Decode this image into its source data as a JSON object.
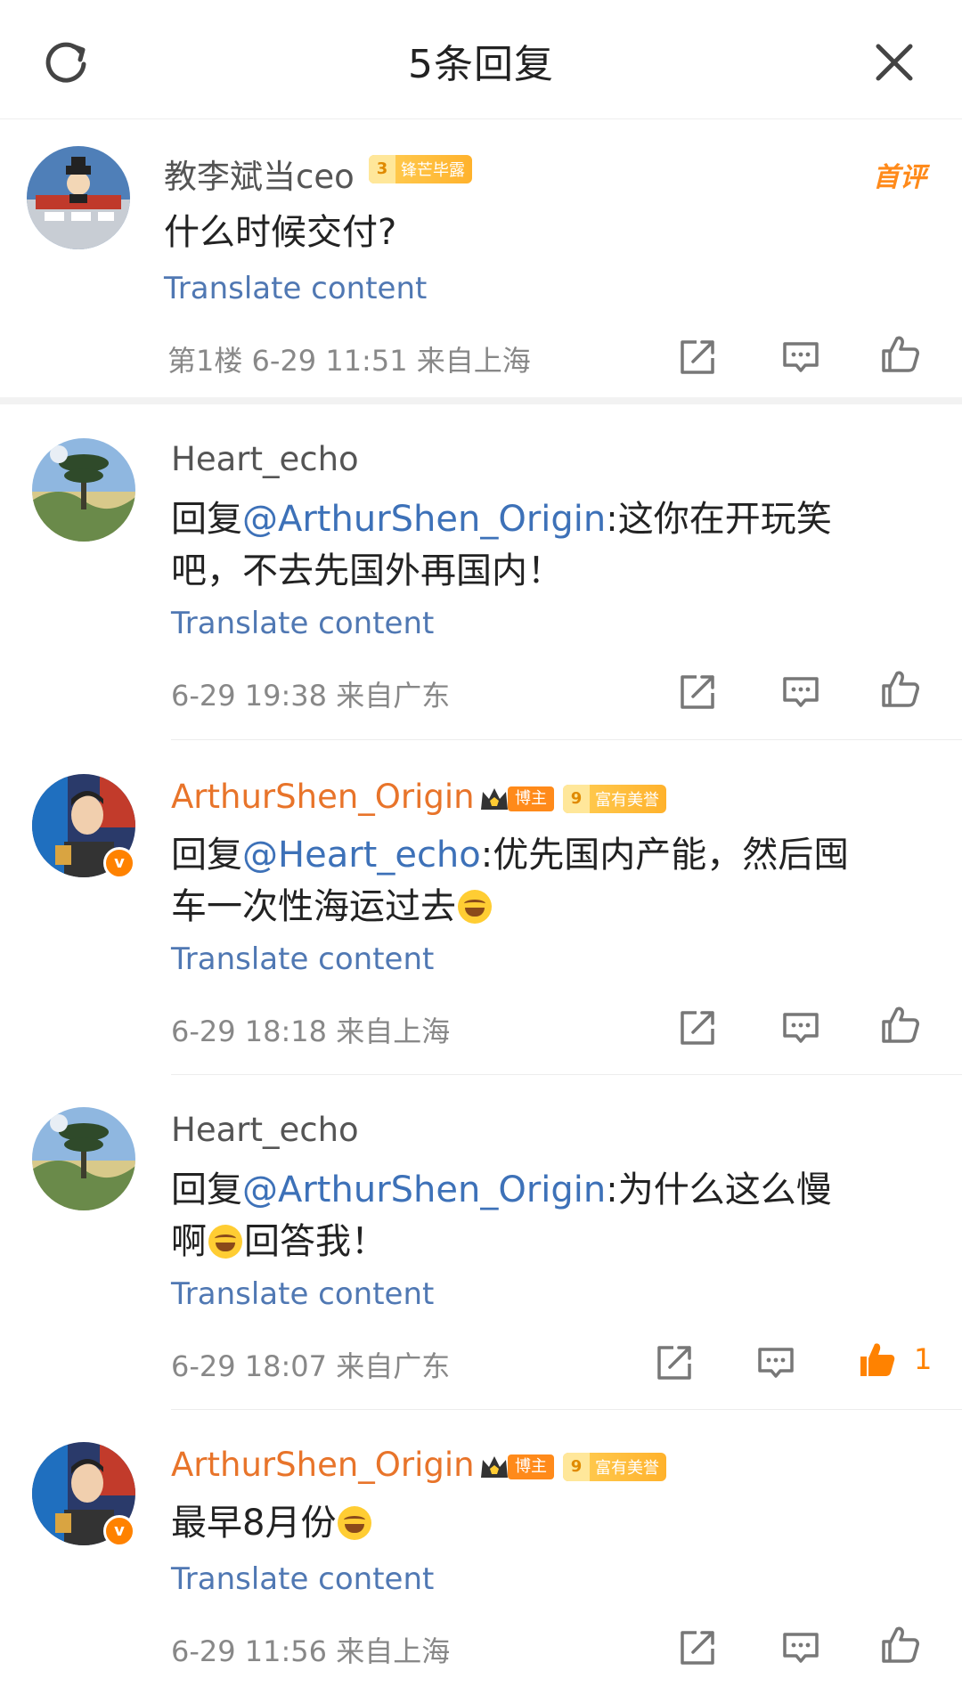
{
  "header": {
    "title": "5条回复"
  },
  "top_comment": {
    "username": "教李斌当ceo",
    "badge_level": "3",
    "badge_text": "锋芒毕露",
    "tag": "首评",
    "text": "什么时候交付?",
    "translate": "Translate content",
    "meta": "第1楼  6-29 11:51  来自上海"
  },
  "replies": [
    {
      "username": "Heart_echo",
      "prefix": "回复",
      "mention": "@ArthurShen_Origin",
      "line1_rest": ":这你在开玩笑",
      "line2": "吧，不去先国外再国内！",
      "translate": "Translate content",
      "meta": "6-29 19:38  来自广东"
    },
    {
      "username": "ArthurShen_Origin",
      "boss_badge": "博主",
      "badge_level": "9",
      "badge_text": "富有美誉",
      "prefix": "回复",
      "mention": "@Heart_echo",
      "line1_rest": ":优先国内产能，然后囤",
      "line2": "车一次性海运过去",
      "translate": "Translate content",
      "meta": "6-29 18:18  来自上海"
    },
    {
      "username": "Heart_echo",
      "prefix": "回复",
      "mention": "@ArthurShen_Origin",
      "line1_rest": ":为什么这么慢",
      "line2a": "啊",
      "line2b": "回答我！",
      "translate": "Translate content",
      "meta": "6-29 18:07  来自广东",
      "like_count": "1"
    },
    {
      "username": "ArthurShen_Origin",
      "boss_badge": "博主",
      "badge_level": "9",
      "badge_text": "富有美誉",
      "text": "最早8月份",
      "translate": "Translate content",
      "meta": "6-29 11:56  来自上海"
    }
  ],
  "colors": {
    "mention": "#3d71b8",
    "username_vip": "#e8742a",
    "accent": "#ff8200"
  },
  "icons": [
    "refresh-icon",
    "close-icon",
    "share-icon",
    "comment-icon",
    "like-icon"
  ]
}
